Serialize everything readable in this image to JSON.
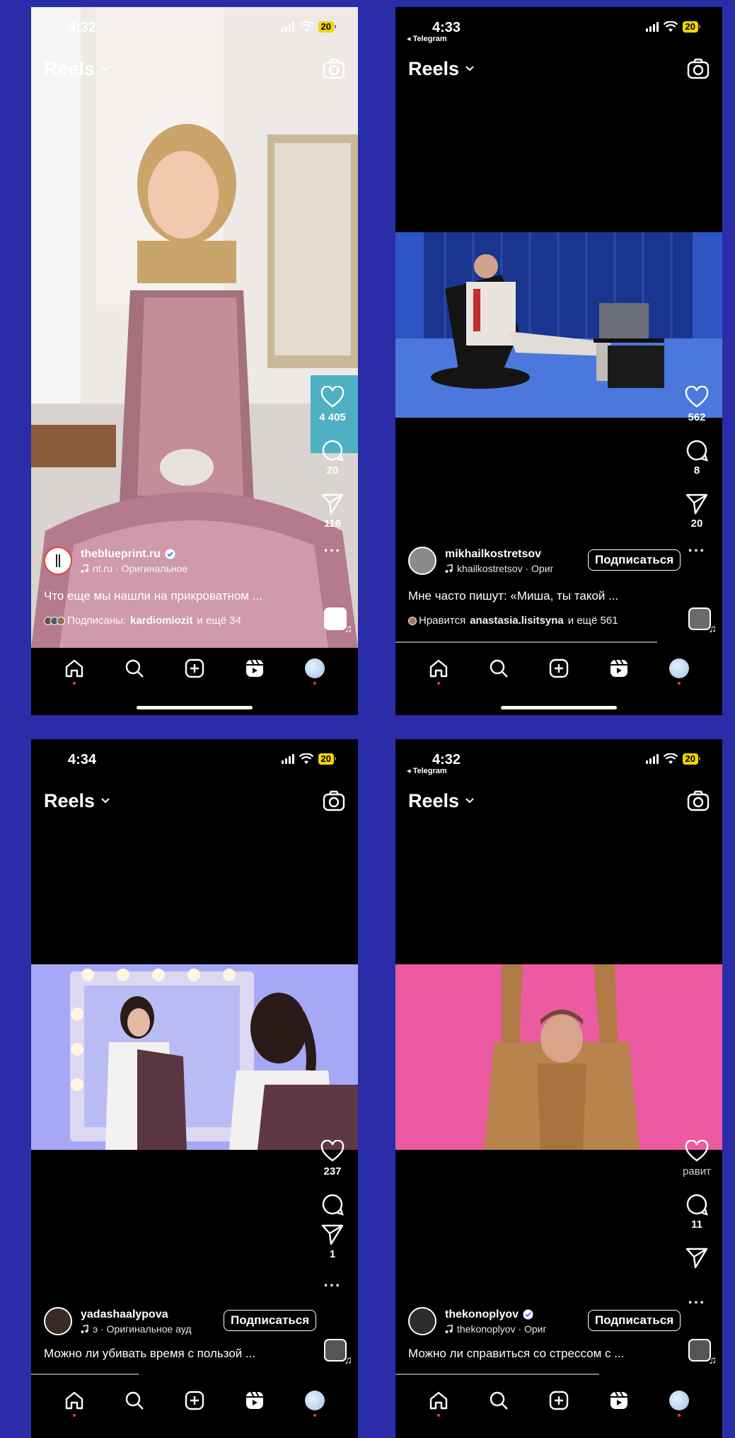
{
  "screens": [
    {
      "time": "4:32",
      "back_label": "",
      "battery": "20",
      "title": "Reels",
      "actions": {
        "likes": "4 405",
        "comments": "20",
        "shares": "116"
      },
      "author": {
        "username": "theblueprint.ru",
        "audio": "nt.ru · Оригинальное"
      },
      "follow_label": "",
      "caption": "Что еще мы нашли на прикроватном ...",
      "social": {
        "prefix": "Подписаны:",
        "name": "kardiomiozit",
        "suffix": "и ещё 34"
      }
    },
    {
      "time": "4:33",
      "back_label": "◂ Telegram",
      "battery": "20",
      "title": "Reels",
      "actions": {
        "likes": "562",
        "comments": "8",
        "shares": "20"
      },
      "author": {
        "username": "mikhailkostretsov",
        "audio": "khailkostretsov · Ориг"
      },
      "follow_label": "Подписаться",
      "caption": "Мне часто пишут: «Миша, ты такой ...",
      "social": {
        "prefix": "Нравится",
        "name": "anastasia.lisitsyna",
        "suffix": "и ещё 561"
      }
    },
    {
      "time": "4:34",
      "back_label": "",
      "battery": "20",
      "title": "Reels",
      "actions": {
        "likes": "237",
        "comments": "",
        "shares": "1"
      },
      "author": {
        "username": "yadashaalypova",
        "audio": "э · Оригинальное ауд"
      },
      "follow_label": "Подписаться",
      "caption": "Можно ли убивать время с пользой ...",
      "social": {
        "prefix": "",
        "name": "",
        "suffix": ""
      }
    },
    {
      "time": "4:32",
      "back_label": "◂ Telegram",
      "battery": "20",
      "title": "Reels",
      "actions": {
        "likes": "равит",
        "comments": "11",
        "shares": ""
      },
      "author": {
        "username": "thekonoplyov",
        "audio": "thekonoplyov · Ориг"
      },
      "follow_label": "Подписаться",
      "caption": "Можно ли справиться со стрессом с ...",
      "social": {
        "prefix": "",
        "name": "",
        "suffix": ""
      }
    }
  ],
  "colors": {
    "background": "#2b2ca8",
    "battery": "#f3d400",
    "notification_dot": "#ff2d55"
  }
}
